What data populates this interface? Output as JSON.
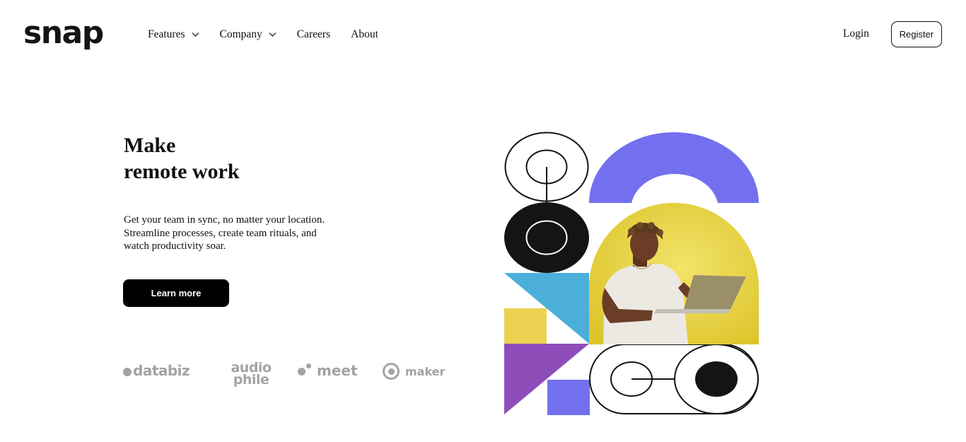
{
  "header": {
    "logo": "snap",
    "nav": [
      {
        "label": "Features",
        "has_dropdown": true
      },
      {
        "label": "Company",
        "has_dropdown": true
      },
      {
        "label": "Careers",
        "has_dropdown": false
      },
      {
        "label": "About",
        "has_dropdown": false
      }
    ],
    "login_label": "Login",
    "register_label": "Register"
  },
  "hero": {
    "title_line1": "Make",
    "title_line2": "remote work",
    "desc_line1": "Get your team in sync, no matter your location.",
    "desc_line2": "Streamline processes, create team rituals, and",
    "desc_line3": "watch productivity soar.",
    "cta_label": "Learn more"
  },
  "clients": {
    "databiz": "databiz",
    "audiophile_line1": "audio",
    "audiophile_line2": "phile",
    "meet": "meet",
    "maker": "maker"
  },
  "colors": {
    "purple": "#7370ef",
    "teal": "#4bafd9",
    "yellow": "#ecd252",
    "violet": "#8e4eba",
    "photo_yellow": "#e6cf33",
    "dark": "#141414",
    "logo_gray": "#a3a3a3"
  },
  "icons": {
    "chevron": "chevron-down-icon",
    "photo": "person-with-laptop-photo"
  }
}
